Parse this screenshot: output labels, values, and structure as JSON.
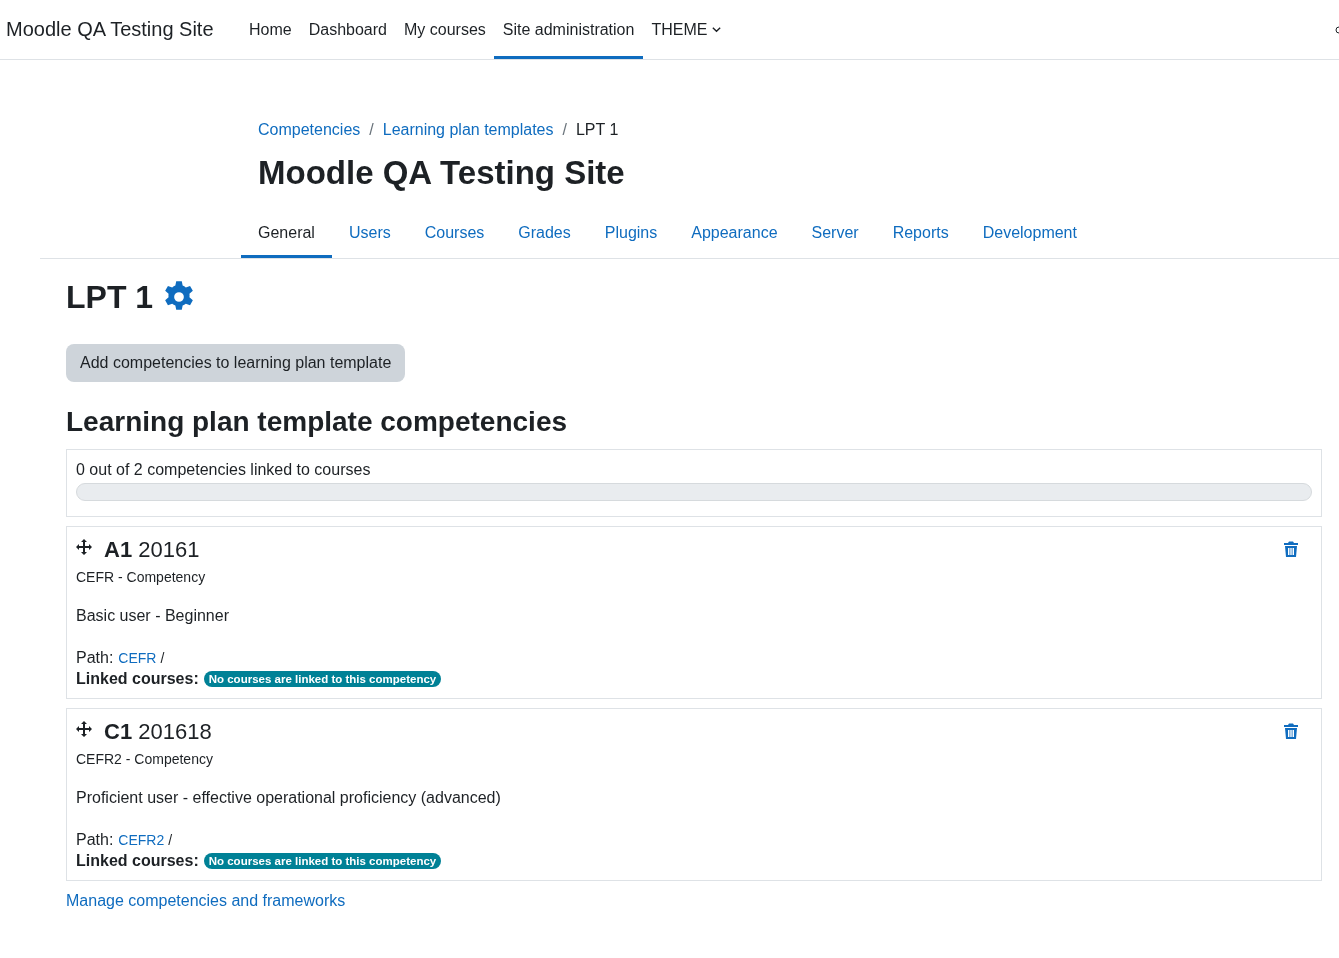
{
  "navbar": {
    "brand": "Moodle QA Testing Site",
    "items": [
      {
        "label": "Home",
        "selected": false,
        "kind": "link"
      },
      {
        "label": "Dashboard",
        "selected": false,
        "kind": "link"
      },
      {
        "label": "My courses",
        "selected": false,
        "kind": "link"
      },
      {
        "label": "Site administration",
        "selected": true,
        "kind": "link"
      },
      {
        "label": "THEME",
        "selected": false,
        "kind": "dropdown"
      }
    ]
  },
  "breadcrumbs": [
    {
      "label": "Competencies",
      "kind": "link"
    },
    {
      "label": "/",
      "kind": "separator"
    },
    {
      "label": "Learning plan templates",
      "kind": "link"
    },
    {
      "label": "/",
      "kind": "separator"
    },
    {
      "label": "LPT 1",
      "kind": "current"
    }
  ],
  "page_title": "Moodle QA Testing Site",
  "tabs": [
    {
      "label": "General",
      "selected": true
    },
    {
      "label": "Users",
      "selected": false
    },
    {
      "label": "Courses",
      "selected": false
    },
    {
      "label": "Grades",
      "selected": false
    },
    {
      "label": "Plugins",
      "selected": false
    },
    {
      "label": "Appearance",
      "selected": false
    },
    {
      "label": "Server",
      "selected": false
    },
    {
      "label": "Reports",
      "selected": false
    },
    {
      "label": "Development",
      "selected": false
    }
  ],
  "template_title": "LPT 1",
  "add_button": "Add competencies to learning plan template",
  "section_title": "Learning plan template competencies",
  "progress": {
    "text": "0 out of 2 competencies linked to courses",
    "level": 0
  },
  "competencies": [
    {
      "shortname": "A1",
      "idnumber": "20161",
      "framework": "CEFR - Competency",
      "description": "Basic user - Beginner",
      "path_label": "Path:",
      "path_link": "CEFR",
      "path_sep": "/",
      "linked_label": "Linked courses:",
      "linked_badge": "No courses are linked to this competency"
    },
    {
      "shortname": "C1",
      "idnumber": "201618",
      "framework": "CEFR2 - Competency",
      "description": "Proficient user - effective operational proficiency (advanced)",
      "path_label": "Path:",
      "path_link": "CEFR2",
      "path_sep": "/",
      "linked_label": "Linked courses:",
      "linked_badge": "No courses are linked to this competency"
    }
  ],
  "footer_link": "Manage competencies and frameworks"
}
